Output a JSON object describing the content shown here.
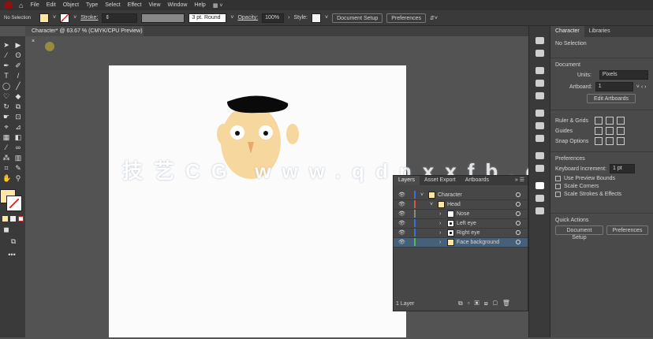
{
  "menu": [
    "File",
    "Edit",
    "Object",
    "Type",
    "Select",
    "Effect",
    "View",
    "Window",
    "Help"
  ],
  "control": {
    "selection": "No Selection",
    "stroke_label": "Stroke:",
    "brush": "3 pt. Round",
    "opacity_label": "Opacity:",
    "opacity": "100%",
    "style_label": "Style:",
    "doc_setup": "Document Setup",
    "preferences": "Preferences",
    "fill_color": "#fde6a8"
  },
  "doc_tab": {
    "title": "Character* @ 63.67 % (CMYK/CPU Preview)",
    "close": "×"
  },
  "watermark": "技艺CG www.qdnxxfb.cn",
  "properties": {
    "tabs": [
      "Character",
      "Libraries"
    ],
    "no_selection": "No Selection",
    "document": "Document",
    "units_label": "Units:",
    "units": "Pixels",
    "artboard_label": "Artboard:",
    "artboard": "1",
    "edit_artboards": "Edit Artboards",
    "ruler_grids": "Ruler & Grids",
    "guides": "Guides",
    "snap_options": "Snap Options",
    "preferences": "Preferences",
    "keyboard_increment_label": "Keyboard Increment:",
    "keyboard_increment": "1 pt",
    "checkboxes": [
      "Use Preview Bounds",
      "Scale Corners",
      "Scale Strokes & Effects"
    ],
    "quick_actions": "Quick Actions",
    "doc_setup": "Document Setup",
    "prefs_button": "Preferences"
  },
  "layers": {
    "tabs": [
      "Layers",
      "Asset Export",
      "Artboards"
    ],
    "rows": [
      {
        "name": "Character",
        "color": "#3d6fd8",
        "indent": 0,
        "expanded": true
      },
      {
        "name": "Head",
        "color": "#d85a3d",
        "indent": 1,
        "expanded": true
      },
      {
        "name": "Nose",
        "color": "#888888",
        "indent": 2
      },
      {
        "name": "Left eye",
        "color": "#3d6fd8",
        "indent": 2
      },
      {
        "name": "Right eye",
        "color": "#3d6fd8",
        "indent": 2
      },
      {
        "name": "Face background",
        "color": "#4fc04f",
        "indent": 2,
        "selected": true
      }
    ],
    "count": "1 Layer"
  }
}
